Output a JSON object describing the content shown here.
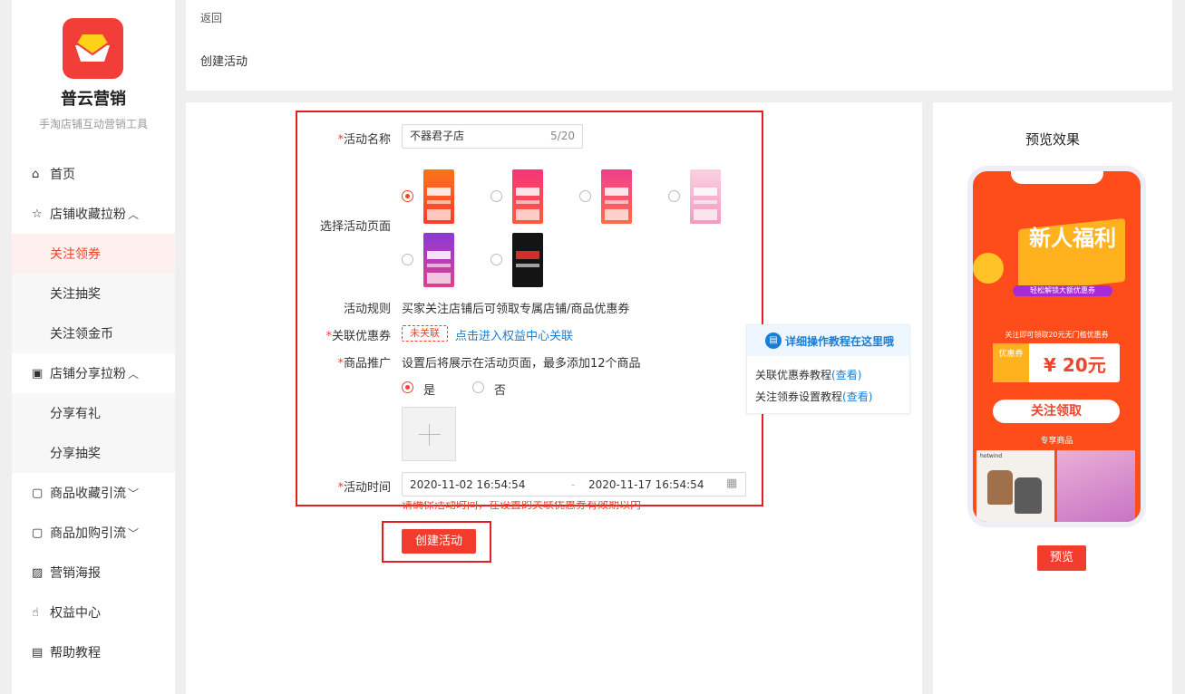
{
  "sidebar": {
    "app_name": "普云营销",
    "app_subtitle": "手淘店铺互动营销工具",
    "items": [
      {
        "label": "首页",
        "icon": "home-icon"
      },
      {
        "label": "店铺收藏拉粉",
        "icon": "star-icon"
      },
      {
        "label": "关注领券"
      },
      {
        "label": "关注抽奖"
      },
      {
        "label": "关注领金币"
      },
      {
        "label": "店铺分享拉粉",
        "icon": "store-icon"
      },
      {
        "label": "分享有礼"
      },
      {
        "label": "分享抽奖"
      },
      {
        "label": "商品收藏引流",
        "icon": "bag-icon"
      },
      {
        "label": "商品加购引流",
        "icon": "cart-bag-icon"
      },
      {
        "label": "营销海报",
        "icon": "image-icon"
      },
      {
        "label": "权益中心",
        "icon": "thumb-icon"
      },
      {
        "label": "帮助教程",
        "icon": "doc-icon"
      }
    ]
  },
  "header": {
    "back_label": "返回",
    "title": "创建活动"
  },
  "form": {
    "name_label": "活动名称",
    "name_value": "不器君子店",
    "name_counter": "5/20",
    "page_label": "选择活动页面",
    "rules_label": "活动规则",
    "rules_text": "买家关注店铺后可领取专属店铺/商品优惠券",
    "coupon_label": "关联优惠券",
    "coupon_tag": "未关联",
    "coupon_link": "点击进入权益中心关联",
    "promo_label": "商品推广",
    "promo_text": "设置后将展示在活动页面，最多添加12个商品",
    "promo_yes": "是",
    "promo_no": "否",
    "time_label": "活动时间",
    "time_start": "2020-11-02 16:54:54",
    "time_sep": "-",
    "time_end": "2020-11-17 16:54:54",
    "time_warning": "请确保活动时间，在设置的关联优惠券有效期以内",
    "create_button": "创建活动"
  },
  "help": {
    "title": "详细操作教程在这里哦",
    "line1": "关联优惠券教程",
    "line2": "关注领券设置教程",
    "view": "(查看)"
  },
  "preview": {
    "title": "预览效果",
    "banner_title": "新人福利",
    "banner_sub": "轻松解锁大额优惠券",
    "coupon_desc": "关注即可领取20元无门槛优惠券",
    "coupon_side": "优惠券",
    "coupon_amount": "¥ 20元",
    "follow_button": "关注领取",
    "products_label": "专享商品",
    "product_brand": "hotwind",
    "preview_button": "预览"
  },
  "colors": {
    "accent": "#f23d2e",
    "link": "#1a7fd4",
    "highlight_border": "#e02020"
  }
}
